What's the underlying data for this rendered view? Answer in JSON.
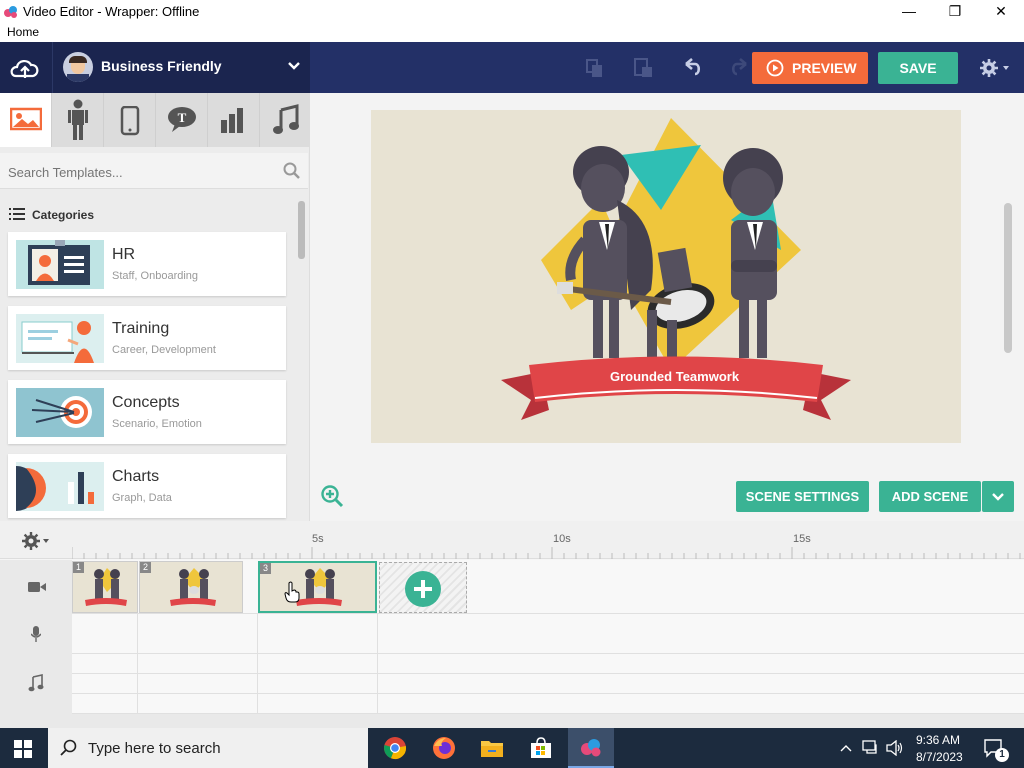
{
  "window": {
    "title": "Video Editor - Wrapper: Offline",
    "menu_home": "Home"
  },
  "toolbar": {
    "theme_name": "Business Friendly",
    "preview_label": "PREVIEW",
    "save_label": "SAVE"
  },
  "left_panel": {
    "search_placeholder": "Search Templates...",
    "categories_label": "Categories",
    "cards": [
      {
        "title": "HR",
        "subtitle": "Staff, Onboarding"
      },
      {
        "title": "Training",
        "subtitle": "Career, Development"
      },
      {
        "title": "Concepts",
        "subtitle": "Scenario, Emotion"
      },
      {
        "title": "Charts",
        "subtitle": "Graph, Data"
      }
    ]
  },
  "stage": {
    "banner_text": "Grounded Teamwork",
    "scene_settings_label": "SCENE SETTINGS",
    "add_scene_label": "ADD SCENE"
  },
  "timeline": {
    "ruler_labels": [
      "5s",
      "10s",
      "15s"
    ],
    "scene_numbers": [
      "1",
      "2",
      "3"
    ]
  },
  "taskbar": {
    "search_text": "Type here to search",
    "time": "9:36 AM",
    "date": "8/7/2023",
    "notification_count": "1"
  },
  "colors": {
    "topbar": "#233067",
    "preview": "#f46b3b",
    "accent_green": "#3ab394",
    "banner_red": "#e04548"
  }
}
